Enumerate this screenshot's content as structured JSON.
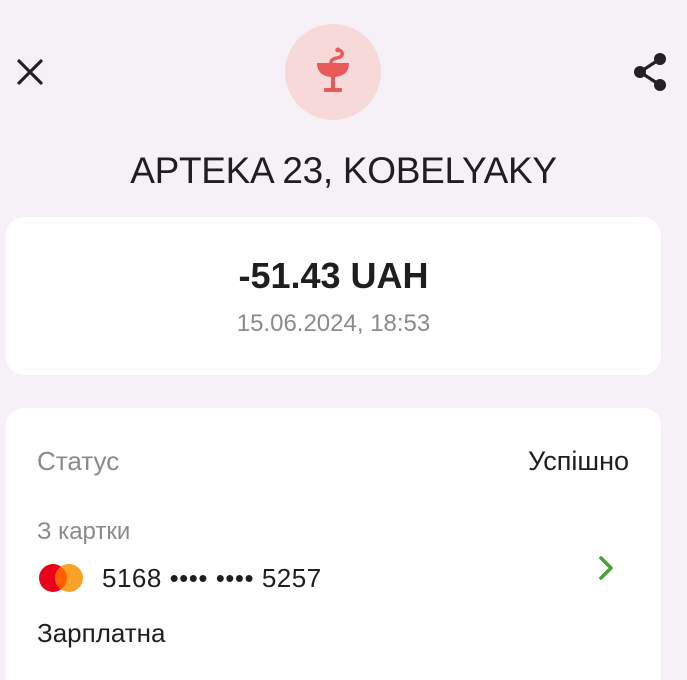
{
  "header": {
    "merchant_name": "APTEKA 23, KOBELYAKY",
    "merchant_icon": "pharmacy-bowl-of-hygieia-icon",
    "close_icon": "close-icon",
    "share_icon": "share-icon"
  },
  "transaction": {
    "amount": "-51.43 UAH",
    "datetime": "15.06.2024, 18:53"
  },
  "details": {
    "status_label": "Статус",
    "status_value": "Успішно",
    "from_card_label": "З картки",
    "card_number": "5168 •••• •••• 5257",
    "card_name": "Зарплатна",
    "card_brand_icon": "mastercard-logo-icon"
  },
  "colors": {
    "accent_green": "#4aa335",
    "pharmacy_red": "#e85a5a",
    "pharmacy_bg": "#f8d9d9"
  }
}
